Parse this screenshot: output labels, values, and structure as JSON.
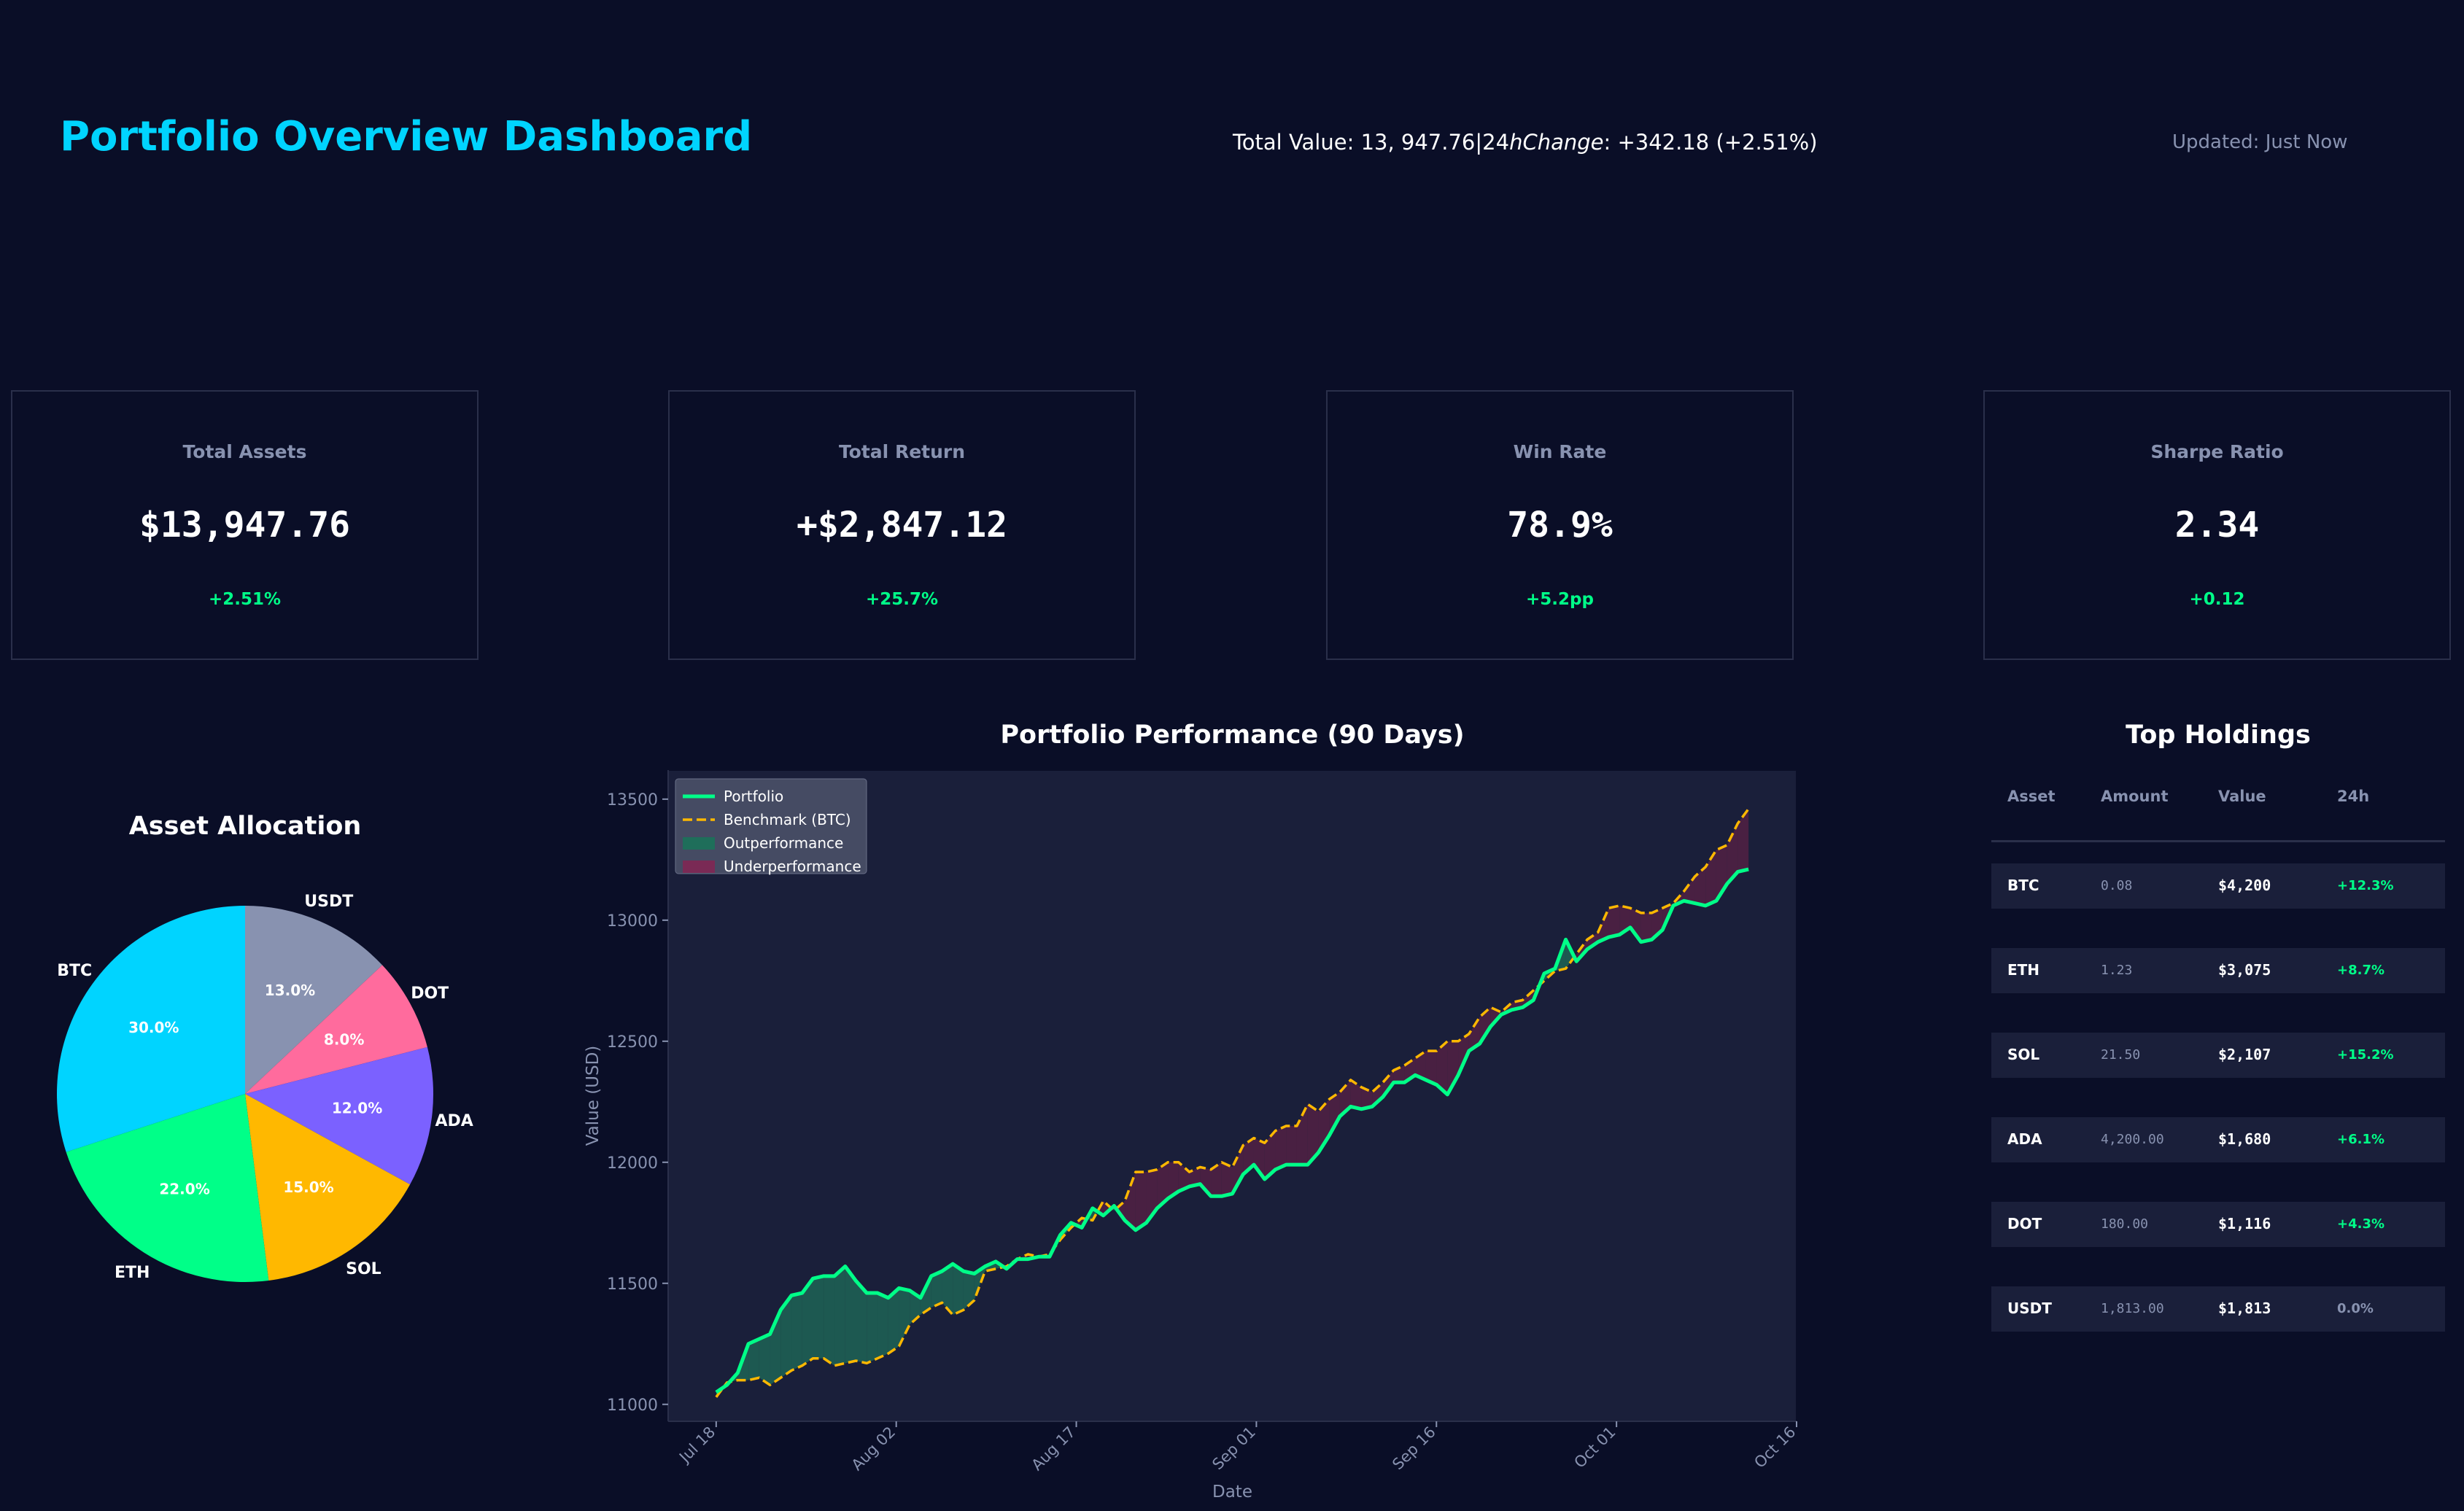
{
  "header": {
    "title": "Portfolio Overview Dashboard",
    "summary_pre": "Total Value: 13, 947.76|24",
    "summary_italic": "hChange",
    "summary_post": ": +342.18 (+2.51%)",
    "updated": "Updated: Just Now"
  },
  "kpis": [
    {
      "label": "Total Assets",
      "value": "$13,947.76",
      "delta": "+2.51%"
    },
    {
      "label": "Total Return",
      "value": "+$2,847.12",
      "delta": "+25.7%"
    },
    {
      "label": "Win Rate",
      "value": "78.9%",
      "delta": "+5.2pp"
    },
    {
      "label": "Sharpe Ratio",
      "value": "2.34",
      "delta": "+0.12"
    }
  ],
  "colors": {
    "background": "#0a0e27",
    "accent": "#00d4ff",
    "positive": "#00ff88",
    "muted": "#8892b0",
    "panel": "#1a1f3a"
  },
  "holdings": {
    "title": "Top Holdings",
    "columns": [
      "Asset",
      "Amount",
      "Value",
      "24h"
    ],
    "rows": [
      {
        "asset": "BTC",
        "amount": "0.08",
        "value": "$4,200",
        "change": "+12.3%"
      },
      {
        "asset": "ETH",
        "amount": "1.23",
        "value": "$3,075",
        "change": "+8.7%"
      },
      {
        "asset": "SOL",
        "amount": "21.50",
        "value": "$2,107",
        "change": "+15.2%"
      },
      {
        "asset": "ADA",
        "amount": "4,200.00",
        "value": "$1,680",
        "change": "+6.1%"
      },
      {
        "asset": "DOT",
        "amount": "180.00",
        "value": "$1,116",
        "change": "+4.3%"
      },
      {
        "asset": "USDT",
        "amount": "1,813.00",
        "value": "$1,813",
        "change": "0.0%"
      }
    ]
  },
  "chart_data": [
    {
      "type": "pie",
      "title": "Asset Allocation",
      "slices": [
        {
          "label": "USDT",
          "value": 13.0,
          "color": "#8892b0"
        },
        {
          "label": "DOT",
          "value": 8.0,
          "color": "#ff6b9d"
        },
        {
          "label": "ADA",
          "value": 12.0,
          "color": "#7b61ff"
        },
        {
          "label": "SOL",
          "value": 15.0,
          "color": "#ffb800"
        },
        {
          "label": "ETH",
          "value": 22.0,
          "color": "#00ff88"
        },
        {
          "label": "BTC",
          "value": 30.0,
          "color": "#00d4ff"
        }
      ]
    },
    {
      "type": "line",
      "title": "Portfolio Performance (90 Days)",
      "xlabel": "Date",
      "ylabel": "Value (USD)",
      "ylim": [
        10930,
        13620
      ],
      "xlim": [
        "2024-07-14",
        "2024-10-16"
      ],
      "yticks": [
        11000,
        11500,
        12000,
        12500,
        13000,
        13500
      ],
      "xticks": [
        {
          "date": "2024-07-18",
          "label": "Jul 18"
        },
        {
          "date": "2024-08-02",
          "label": "Aug 02"
        },
        {
          "date": "2024-08-17",
          "label": "Aug 17"
        },
        {
          "date": "2024-09-01",
          "label": "Sep 01"
        },
        {
          "date": "2024-09-16",
          "label": "Sep 16"
        },
        {
          "date": "2024-10-01",
          "label": "Oct 01"
        },
        {
          "date": "2024-10-16",
          "label": "Oct 16"
        }
      ],
      "legend": {
        "position": "top-left",
        "entries": [
          "Portfolio",
          "Benchmark (BTC)",
          "Outperformance",
          "Underperformance"
        ]
      },
      "x_start": "2024-07-18",
      "x_end": "2024-10-12",
      "series": [
        {
          "name": "Portfolio",
          "color": "#00ff88",
          "values": [
            11050,
            11080,
            11130,
            11250,
            11270,
            11290,
            11390,
            11450,
            11460,
            11520,
            11530,
            11530,
            11570,
            11510,
            11460,
            11460,
            11440,
            11480,
            11470,
            11440,
            11530,
            11550,
            11580,
            11550,
            11540,
            11570,
            11590,
            11560,
            11600,
            11600,
            11610,
            11610,
            11700,
            11750,
            11730,
            11810,
            11780,
            11820,
            11760,
            11720,
            11750,
            11810,
            11850,
            11880,
            11900,
            11910,
            11860,
            11860,
            11870,
            11950,
            11990,
            11930,
            11970,
            11990,
            11990,
            11990,
            12040,
            12110,
            12190,
            12230,
            12220,
            12230,
            12270,
            12330,
            12330,
            12360,
            12340,
            12320,
            12280,
            12360,
            12460,
            12490,
            12560,
            12610,
            12630,
            12640,
            12670,
            12780,
            12800,
            12920,
            12830,
            12880,
            12910,
            12930,
            12940,
            12970,
            12910,
            12920,
            12960,
            13060,
            13080,
            13070,
            13060,
            13080,
            13150,
            13200,
            13210,
            13260
          ]
        },
        {
          "name": "Benchmark (BTC)",
          "color": "#ffb800",
          "values": [
            11030,
            11090,
            11100,
            11100,
            11110,
            11080,
            11110,
            11140,
            11160,
            11190,
            11190,
            11160,
            11170,
            11180,
            11170,
            11190,
            11210,
            11240,
            11330,
            11370,
            11400,
            11420,
            11370,
            11390,
            11430,
            11550,
            11560,
            11570,
            11600,
            11620,
            11610,
            11620,
            11680,
            11730,
            11770,
            11760,
            11840,
            11800,
            11840,
            11960,
            11960,
            11970,
            12000,
            12000,
            11960,
            11980,
            11970,
            12000,
            11980,
            12070,
            12100,
            12080,
            12130,
            12150,
            12150,
            12240,
            12210,
            12260,
            12290,
            12340,
            12310,
            12290,
            12330,
            12380,
            12400,
            12430,
            12460,
            12460,
            12500,
            12500,
            12530,
            12600,
            12640,
            12620,
            12660,
            12670,
            12710,
            12750,
            12790,
            12800,
            12860,
            12920,
            12950,
            13050,
            13060,
            13050,
            13030,
            13030,
            13050,
            13070,
            13120,
            13180,
            13220,
            13290,
            13310,
            13400,
            13460
          ]
        }
      ]
    }
  ]
}
